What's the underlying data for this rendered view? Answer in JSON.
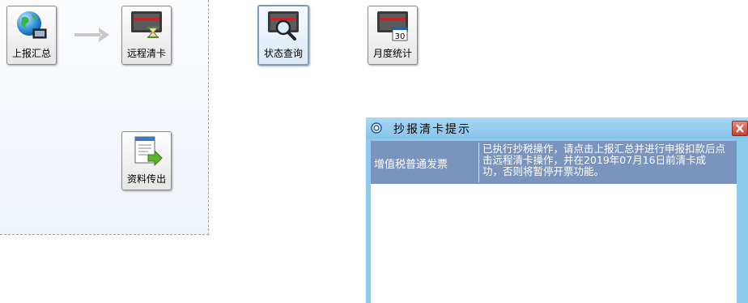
{
  "tiles": {
    "upload_summary": "上报汇总",
    "remote_clear": "远程清卡",
    "status_query": "状态查询",
    "monthly_stats": "月度统计",
    "data_export": "资料传出"
  },
  "monthly_icon_number": "30",
  "dialog": {
    "title": "抄报清卡提示",
    "rows": [
      {
        "category": "增值税普通发票",
        "message": "已执行抄税操作，请点击上报汇总并进行申报扣款后点击远程清卡操作，并在2019年07月16日前清卡成功，否则将暂停开票功能。"
      }
    ]
  },
  "colors": {
    "dialog_frame": "#8ec9ee",
    "message_row_bg": "#7b94bd",
    "close_button": "#c8422e"
  }
}
